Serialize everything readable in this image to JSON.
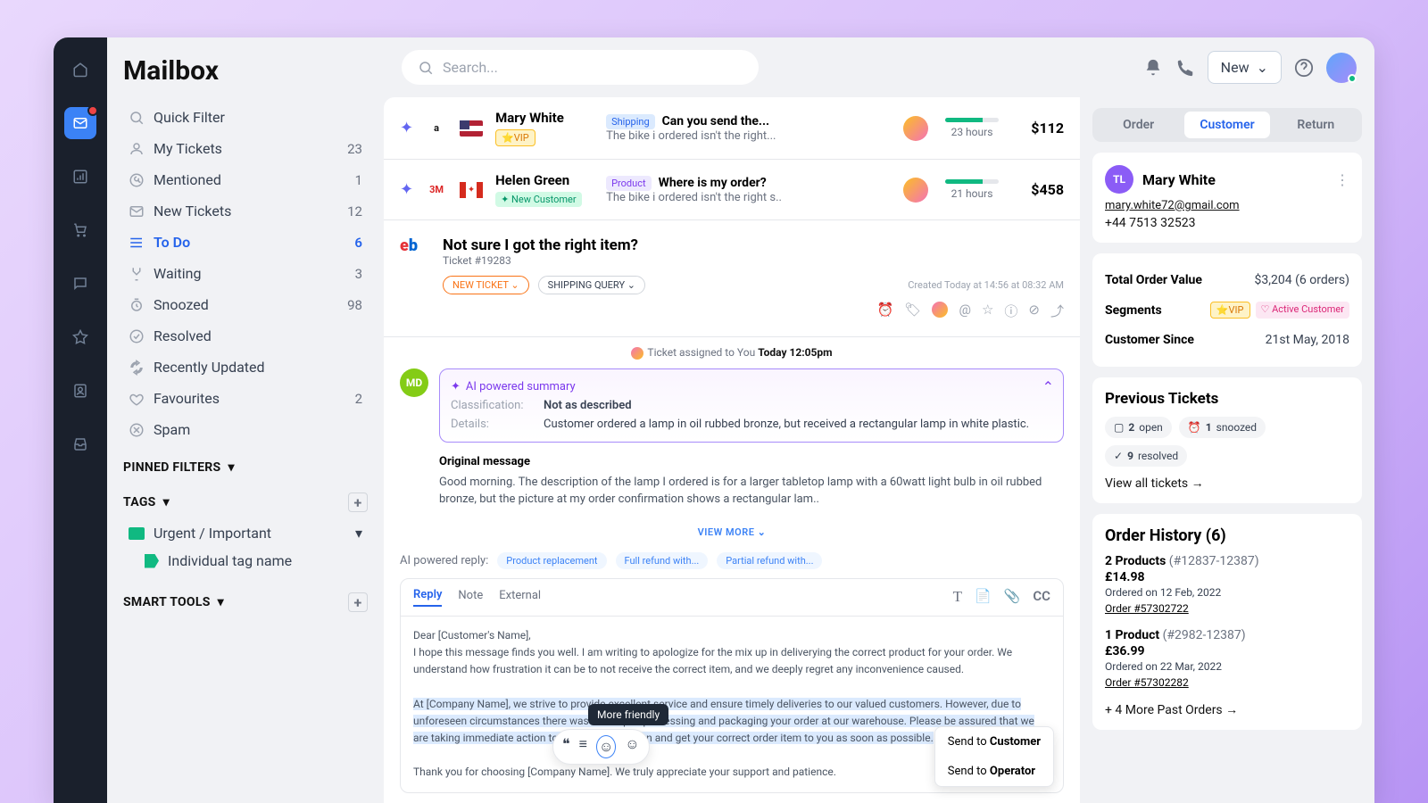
{
  "sidebar": {
    "title": "Mailbox",
    "filters": [
      {
        "label": "Quick Filter",
        "count": ""
      },
      {
        "label": "My Tickets",
        "count": "23"
      },
      {
        "label": "Mentioned",
        "count": "1"
      },
      {
        "label": "New Tickets",
        "count": "12"
      },
      {
        "label": "To Do",
        "count": "6",
        "active": true
      },
      {
        "label": "Waiting",
        "count": "3"
      },
      {
        "label": "Snoozed",
        "count": "98"
      },
      {
        "label": "Resolved",
        "count": ""
      },
      {
        "label": "Recently Updated",
        "count": ""
      },
      {
        "label": "Favourites",
        "count": "2"
      },
      {
        "label": "Spam",
        "count": ""
      }
    ],
    "pinned_header": "PINNED FILTERS",
    "tags_header": "TAGS",
    "tags": [
      {
        "label": "Urgent / Important"
      },
      {
        "label": "Individual tag name"
      }
    ],
    "smart_header": "SMART TOOLS"
  },
  "topbar": {
    "search_placeholder": "Search...",
    "new_label": "New"
  },
  "tickets": [
    {
      "name": "Mary White",
      "badge": "⭐VIP",
      "badge_class": "b-vip",
      "cat": "Shipping",
      "cat_class": "b-ship",
      "subject": "Can you send the...",
      "preview": "The bike i ordered isn't the right...",
      "time": "23 hours",
      "amount": "$112",
      "brand": "a",
      "brand_bg": "#fff",
      "flag": "us"
    },
    {
      "name": "Helen Green",
      "badge": "✦ New Customer",
      "badge_class": "b-new",
      "cat": "Product",
      "cat_class": "b-prod",
      "subject": "Where is my order?",
      "preview": "The bike i ordered isn't the right s..",
      "time": "21 hours",
      "amount": "$458",
      "brand": "3M",
      "brand_bg": "#fff",
      "brand_color": "#dc2626",
      "flag": "ca"
    }
  ],
  "detail": {
    "title": "Not sure I got the right item?",
    "ticket_id": "Ticket #19283",
    "pill_new": "NEW TICKET",
    "pill_ship": "SHIPPING QUERY",
    "created": "Created Today at 14:56 at 08:32 AM",
    "assigned": "Ticket assigned to You",
    "assigned_time": "Today 12:05pm",
    "ai_header": "AI powered summary",
    "classification_k": "Classification:",
    "classification_v": "Not as described",
    "details_k": "Details:",
    "details_v": "Customer ordered a lamp in oil rubbed bronze, but received a rectangular lamp in white plastic.",
    "orig_title": "Original message",
    "orig_body": "Good morning. The description of the lamp I ordered is for a larger tabletop lamp with a 60watt light bulb in oil rubbed bronze, but the picture at my order confirmation shows a rectangular lam..",
    "view_more": "VIEW MORE",
    "avatar_initials": "MD"
  },
  "reply": {
    "ai_label": "AI powered reply:",
    "chips": [
      "Product replacement",
      "Full refund with...",
      "Partial refund with..."
    ],
    "tabs": [
      "Reply",
      "Note",
      "External"
    ],
    "cc": "CC",
    "body_greeting": "Dear [Customer's Name],",
    "body_p1": "I hope this message finds you well. I am writing to apologize for the mix up in deliverying the correct product for your order. We understand how frustration it can be to not receive the correct item, and we deeply regret any inconvenience caused.",
    "body_p2": "At [Company Name], we strive to provide excellent service and ensure timely deliveries to our valued customers. However, due to unforeseen circumstances there was a mixup in processing and packaging your order at our warehouse. Please be assured that we are taking immediate action to rectify the situation and get your correct order item to you as soon as possible.",
    "body_p3": "Thank you for choosing [Company Name]. We truly appreciate your support and patience.",
    "tooltip": "More friendly",
    "send_customer": "Send to",
    "send_customer_b": "Customer",
    "send_operator": "Send to",
    "send_operator_b": "Operator"
  },
  "rpanel": {
    "tabs": [
      "Order",
      "Customer",
      "Return"
    ],
    "cust": {
      "initials": "TL",
      "name": "Mary White",
      "email": "mary.white72@gmail.com",
      "phone": "+44 7513 32523"
    },
    "kv": [
      {
        "k": "Total Order Value",
        "v": "$3,204 (6 orders)"
      },
      {
        "k": "Segments",
        "v": ""
      },
      {
        "k": "Customer Since",
        "v": "21st May, 2018"
      }
    ],
    "seg_vip": "⭐VIP",
    "seg_active": "♡ Active Customer",
    "prev_title": "Previous Tickets",
    "stats": [
      {
        "icon": "▢",
        "n": "2",
        "t": "open"
      },
      {
        "icon": "⏰",
        "n": "1",
        "t": "snoozed"
      },
      {
        "icon": "✓",
        "n": "9",
        "t": "resolved"
      }
    ],
    "viewall": "View all tickets →",
    "ord_title": "Order History (6)",
    "orders": [
      {
        "l1": "2 Products",
        "id": "(#12837-12387)",
        "price": "£14.98",
        "date": "Ordered on 12 Feb, 2022",
        "num": "Order #57302722"
      },
      {
        "l1": "1 Product",
        "id": "(#2982-12387)",
        "price": "£36.99",
        "date": "Ordered on 22 Mar, 2022",
        "num": "Order #57302282"
      }
    ],
    "more_orders": "+ 4 More Past Orders →"
  }
}
